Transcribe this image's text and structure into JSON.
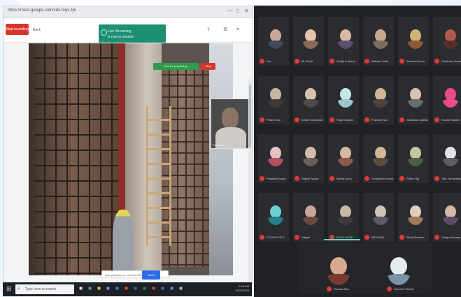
{
  "browser": {
    "title": "https://meet.google.com/xdx-feqv-fyk",
    "record_label": "Stop recording",
    "back_label": "Back",
    "toolbar_icons": [
      "share-icon",
      "settings-icon",
      "close-icon"
    ],
    "toast": {
      "line1": "Live Streaming",
      "line2": "is now in session"
    },
    "video_badge_green": "You are presenting",
    "video_badge_red": "Stop",
    "pip_label": "Presenter",
    "caption_input": "Ask questions or interact with audience",
    "caption_button": "Send",
    "win_controls": [
      "—",
      "□",
      "✕"
    ]
  },
  "taskbar": {
    "search_placeholder": "Type here to search",
    "apps": [
      "app-file-icon",
      "app-edge-icon",
      "app-folder-icon",
      "app-store-icon",
      "app-mail-icon",
      "app-chrome-icon",
      "app-word-icon",
      "app-excel-icon",
      "app-powerpoint-icon",
      "app-teams-icon",
      "app-photos-icon",
      "app-settings-icon"
    ],
    "time": "2:35 PM",
    "date": "10/02/2020"
  },
  "meeting": {
    "participants": [
      {
        "name": "You",
        "c1": "#c9a996",
        "c2": "#3f4a5a"
      },
      {
        "name": "Mr. Rohit",
        "c1": "#e7c3aa",
        "c2": "#8a6a5a"
      },
      {
        "name": "Abhijit Kulkarni",
        "c1": "#d9b8a6",
        "c2": "#5b4f6e"
      },
      {
        "name": "Rakesh Joshi",
        "c1": "#c8a78f",
        "c2": "#7a6e5e"
      },
      {
        "name": "Shweta Kumar",
        "c1": "#d4b07a",
        "c2": "#8a5a3a"
      },
      {
        "name": "Shubham Gupta",
        "c1": "#b05a4a",
        "c2": "#5a2e2a"
      },
      {
        "name": "Pritam Das",
        "c1": "#c9b6a0",
        "c2": "#3e3a38"
      },
      {
        "name": "Aniket Chaudhari",
        "c1": "#d8c2ae",
        "c2": "#4e4a4a"
      },
      {
        "name": "Payal Gawde",
        "c1": "#c2e8e6",
        "c2": "#9ac7c9"
      },
      {
        "name": "Pradeep Sav",
        "c1": "#d0b59a",
        "c2": "#4c433e"
      },
      {
        "name": "Sudhakar Jadhav",
        "c1": "#d9c3b0",
        "c2": "#666e6e"
      },
      {
        "name": "Swami Kadam",
        "c1": "#ec4a8a",
        "c2": "#ec4a8a"
      },
      {
        "name": "Priyanka Gupta",
        "c1": "#e6c1bf",
        "c2": "#b8525e"
      },
      {
        "name": "Sakshi Tawari",
        "c1": "#d6bba6",
        "c2": "#6a5e5a"
      },
      {
        "name": "Neelaj Sahu",
        "c1": "#d8b9a0",
        "c2": "#8a5a4a"
      },
      {
        "name": "Venkatesh Kumar",
        "c1": "#d4b596",
        "c2": "#5a4e3e"
      },
      {
        "name": "Prithvi Raj",
        "c1": "#c3c8a0",
        "c2": "#4b6040"
      },
      {
        "name": "Tina Fernandes",
        "c1": "#e2e2e2",
        "c2": "#5e5e62"
      },
      {
        "name": "GOVIND DC 1",
        "c1": "#6ad0d6",
        "c2": "#277e8a"
      },
      {
        "name": "Nilgani",
        "c1": "#c8a79a",
        "c2": "#6a4a44"
      },
      {
        "name": "RUCC DCEE",
        "c1": "#c9b8a6",
        "c2": "#3e3a3e"
      },
      {
        "name": "MEHDEW",
        "c1": "#cfc2b6",
        "c2": "#5e5a6a"
      },
      {
        "name": "Ritvik Shankar",
        "c1": "#e0d0b8",
        "c2": "#a07a5a"
      },
      {
        "name": "Sudipa Narang",
        "c1": "#d6b7a6",
        "c2": "#5a4f62"
      }
    ],
    "bottom_tiles": [
      {
        "name": "Swetha Ras",
        "c1": "#d7a98f",
        "c2": "#7a3b32"
      },
      {
        "name": "Saurabh Shinde",
        "c1": "#e4ecef",
        "c2": "#7a93a6"
      }
    ]
  }
}
